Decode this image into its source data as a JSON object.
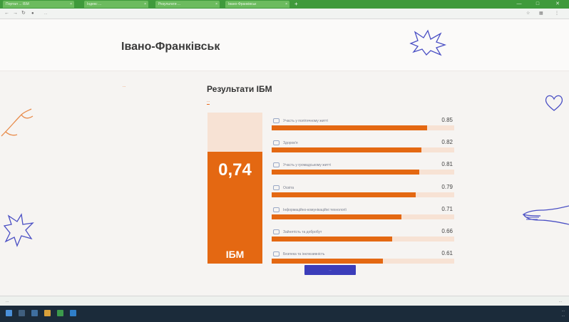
{
  "browser": {
    "tabs": [
      {
        "label": "Портал ... ІБМ",
        "active": false
      },
      {
        "label": "Індекс ...",
        "active": false
      },
      {
        "label": "Результати ...",
        "active": false
      },
      {
        "label": "Івано-Франківськ",
        "active": true
      }
    ],
    "url": "...",
    "new_tab": "+",
    "tab_close": "×"
  },
  "page": {
    "city": "Івано-Франківськ",
    "breadcrumb": "...",
    "results_title": "Результати ІБМ",
    "sub_tab": "...",
    "overall": {
      "value": 0.74,
      "value_text": "0,74",
      "label": "ІБМ"
    },
    "indicators": [
      {
        "label": "Участь у політичному житті",
        "value": 0.85,
        "value_text": "0.85",
        "icon": "people-icon"
      },
      {
        "label": "Здоров'я",
        "value": 0.82,
        "value_text": "0.82",
        "icon": "heart-icon"
      },
      {
        "label": "Участь у громадському житті",
        "value": 0.81,
        "value_text": "0.81",
        "icon": "speech-icon"
      },
      {
        "label": "Освіта",
        "value": 0.79,
        "value_text": "0.79",
        "icon": "book-icon"
      },
      {
        "label": "Інформаційно-комунікаційні технології",
        "value": 0.71,
        "value_text": "0.71",
        "icon": "laptop-icon"
      },
      {
        "label": "Зайнятість та добробут",
        "value": 0.66,
        "value_text": "0.66",
        "icon": "briefcase-icon"
      },
      {
        "label": "Безпека та інклюзивність",
        "value": 0.61,
        "value_text": "0.61",
        "icon": "shield-icon"
      }
    ],
    "button_label": "..."
  },
  "download_bar": {
    "item": "...",
    "show_all": "..."
  },
  "taskbar": {
    "time": "...",
    "date": "..."
  },
  "colors": {
    "accent": "#e46812",
    "track": "#f7e2d4",
    "button": "#3b3dba",
    "deco": "#4a4fc4"
  }
}
